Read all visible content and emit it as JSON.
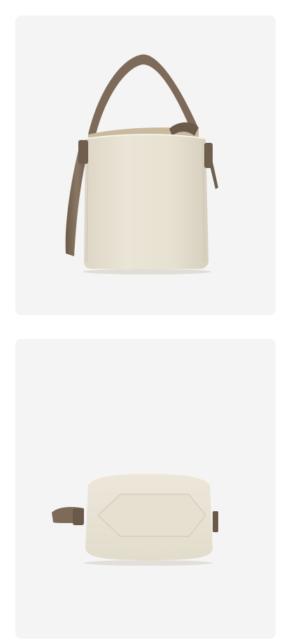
{
  "gallery": {
    "images": [
      {
        "view": "front",
        "kind": "product-photo"
      },
      {
        "view": "bottom",
        "kind": "product-photo"
      }
    ],
    "colors": {
      "page_background": "#ffffff",
      "card_background": "#f4f4f4",
      "bag_body": "#e8e2d3",
      "bag_shade": "#d9d2c1",
      "strap": "#7d6a58",
      "strap_dark": "#5e4f41"
    }
  }
}
